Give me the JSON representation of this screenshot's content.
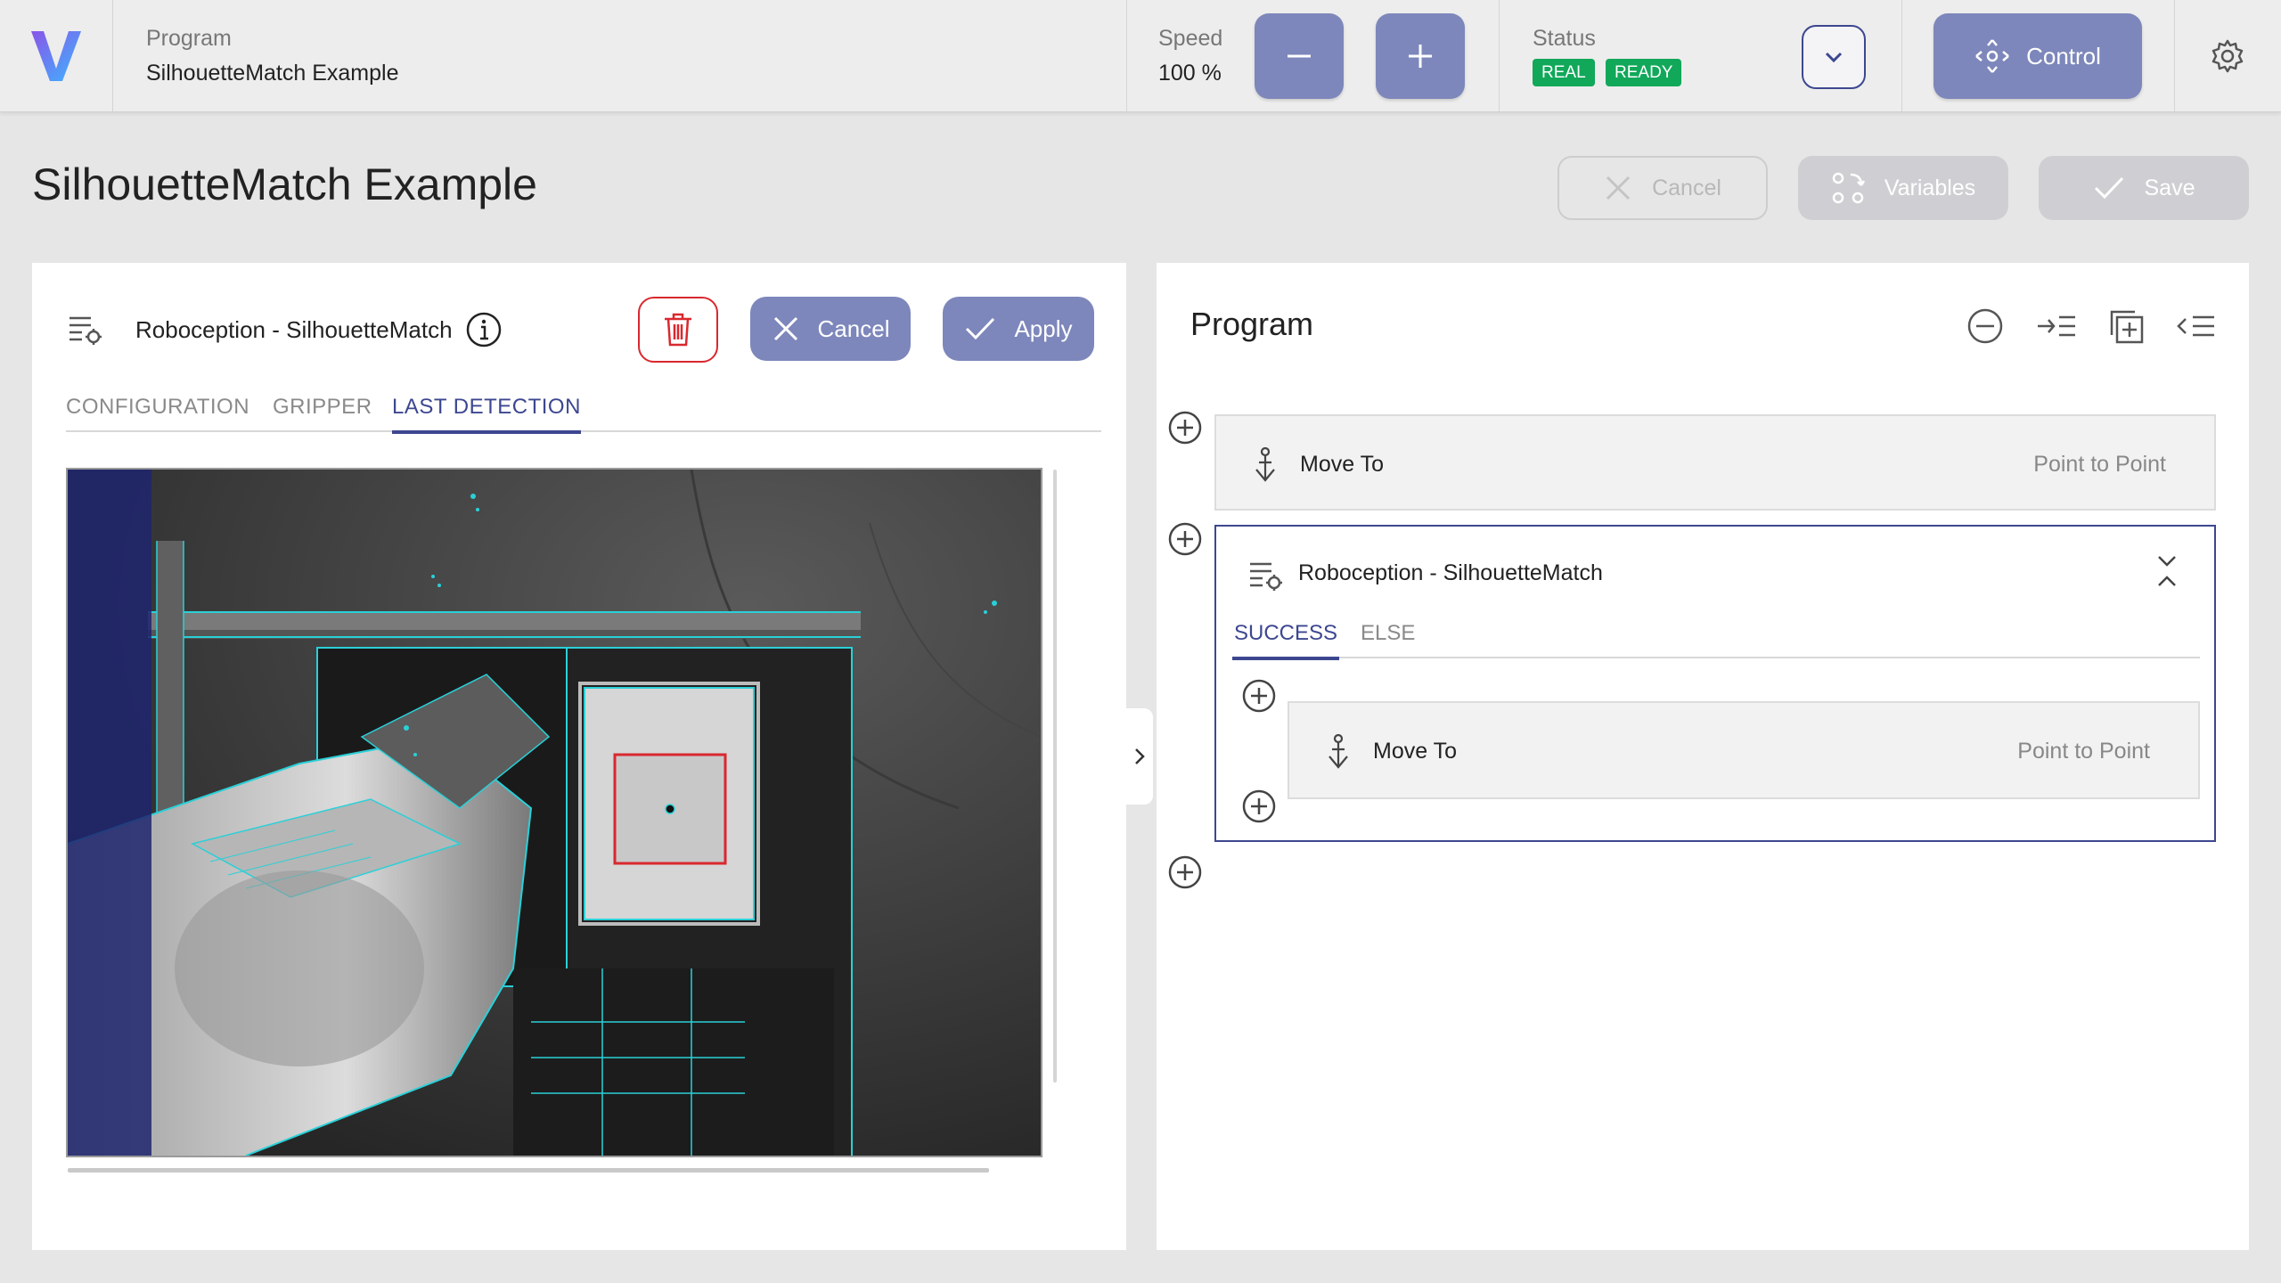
{
  "topbar": {
    "logo_letter": "V",
    "program_label": "Program",
    "program_name": "SilhouetteMatch Example",
    "speed_label": "Speed",
    "speed_value": "100 %",
    "status_label": "Status",
    "status_badges": [
      "REAL",
      "READY"
    ],
    "control_label": "Control"
  },
  "page": {
    "title": "SilhouetteMatch Example",
    "cancel_label": "Cancel",
    "variables_label": "Variables",
    "save_label": "Save"
  },
  "editor": {
    "title": "Roboception - SilhouetteMatch",
    "cancel_label": "Cancel",
    "apply_label": "Apply",
    "tabs": [
      "CONFIGURATION",
      "GRIPPER",
      "LAST DETECTION"
    ],
    "active_tab": "LAST DETECTION"
  },
  "program": {
    "title": "Program",
    "steps": [
      {
        "label": "Move To",
        "type": "Point to Point"
      },
      {
        "label": "Roboception - SilhouetteMatch",
        "tabs": [
          "SUCCESS",
          "ELSE"
        ],
        "active_tab": "SUCCESS",
        "children": [
          {
            "label": "Move To",
            "type": "Point to Point"
          }
        ]
      }
    ]
  },
  "colors": {
    "accent": "#7d87bb",
    "primary": "#3d4790",
    "success": "#11a85a",
    "danger": "#d9282f",
    "detection": "#2ad0d8",
    "logo_gradient": [
      "#8a55e8",
      "#3cb6ff"
    ]
  },
  "icons": [
    "logo",
    "minus-icon",
    "plus-icon",
    "chevron-down-icon",
    "move-icon",
    "gear-icon",
    "close-icon",
    "variables-icon",
    "check-icon",
    "list-settings-icon",
    "info-icon",
    "trash-icon",
    "chevron-right-icon",
    "remove-circle-icon",
    "indent-icon",
    "copy-add-icon",
    "outdent-icon",
    "add-circle-icon",
    "anchor-icon",
    "collapse-icon"
  ]
}
